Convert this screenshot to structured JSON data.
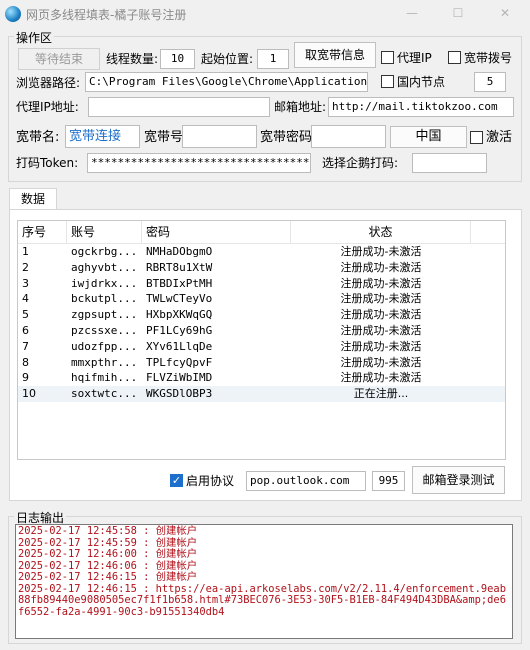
{
  "window": {
    "title": "网页多线程填表-橘子账号注册"
  },
  "ops": {
    "group_label": "操作区",
    "wait_end_button": "等待结束",
    "thread_count_label": "线程数量:",
    "thread_count_value": "10",
    "start_pos_label": "起始位置:",
    "start_pos_value": "1",
    "get_broadband_button": "取宽带信息",
    "proxy_ip_label": "代理IP",
    "broadband_dial_label": "宽带拨号",
    "browser_path_label": "浏览器路径:",
    "browser_path_value": "C:\\Program Files\\Google\\Chrome\\Application\\chrome.exe",
    "domestic_node_label": "国内节点",
    "node_number": "5",
    "proxy_ip_addr_label": "代理IP地址:",
    "proxy_ip_addr_value": "",
    "mail_addr_label": "邮箱地址:",
    "mail_addr_value": "http://mail.tiktokzoo.com",
    "broadband_name_label": "宽带名:",
    "broadband_name_value": "宽带连接",
    "broadband_no_label": "宽带号",
    "broadband_no_value": "",
    "broadband_pwd_label": "宽带密码:",
    "broadband_pwd_value": "",
    "region_value": "中国",
    "activate_label": "激活",
    "captcha_token_label": "打码Token:",
    "captcha_token_value": "************************************",
    "select_penguin_label": "选择企鹅打码:",
    "select_penguin_value": ""
  },
  "data_tab": {
    "label": "数据"
  },
  "table": {
    "columns": [
      "序号",
      "账号",
      "密码",
      "状态"
    ],
    "rows": [
      [
        "1",
        "ogckrbg...",
        "NMHaDObgmO",
        "注册成功-未激活"
      ],
      [
        "2",
        "aghyvbt...",
        "RBRT8u1XtW",
        "注册成功-未激活"
      ],
      [
        "3",
        "iwjdrkx...",
        "BTBDIxPtMH",
        "注册成功-未激活"
      ],
      [
        "4",
        "bckutpl...",
        "TWLwCTeyVo",
        "注册成功-未激活"
      ],
      [
        "5",
        "zgpsupt...",
        "HXbpXKWqGQ",
        "注册成功-未激活"
      ],
      [
        "6",
        "pzcssxe...",
        "PF1LCy69hG",
        "注册成功-未激活"
      ],
      [
        "7",
        "udozfpp...",
        "XYv61LlqDe",
        "注册成功-未激活"
      ],
      [
        "8",
        "mmxpthr...",
        "TPLfcyQpvF",
        "注册成功-未激活"
      ],
      [
        "9",
        "hqifmih...",
        "FLVZiWbIMD",
        "注册成功-未激活"
      ],
      [
        "10",
        "soxtwtc...",
        "WKGSDlOBP3",
        "正在注册..."
      ]
    ]
  },
  "protocol": {
    "enable_label": "启用协议",
    "enabled": true,
    "server_value": "pop.outlook.com",
    "port_value": "995",
    "mail_login_test_button": "邮箱登录测试"
  },
  "log": {
    "group_label": "日志输出",
    "lines": [
      "2025-02-17 12:45:58 : 创建帐户",
      "2025-02-17 12:45:59 : 创建帐户",
      "2025-02-17 12:46:00 : 创建帐户",
      "2025-02-17 12:46:06 : 创建帐户",
      "2025-02-17 12:46:15 : 创建帐户",
      "2025-02-17 12:46:15 : https://ea-api.arkoselabs.com/v2/2.11.4/enforcement.9eab88fb89440e9080505ec7f1f1b658.html#73BEC076-3E53-30F5-B1EB-84F494D43DBA&amp;de6f6552-fa2a-4991-90c3-b91551340db4"
    ]
  },
  "colors": {
    "accent": "#1e6fcc",
    "log_text": "#b0121b"
  }
}
